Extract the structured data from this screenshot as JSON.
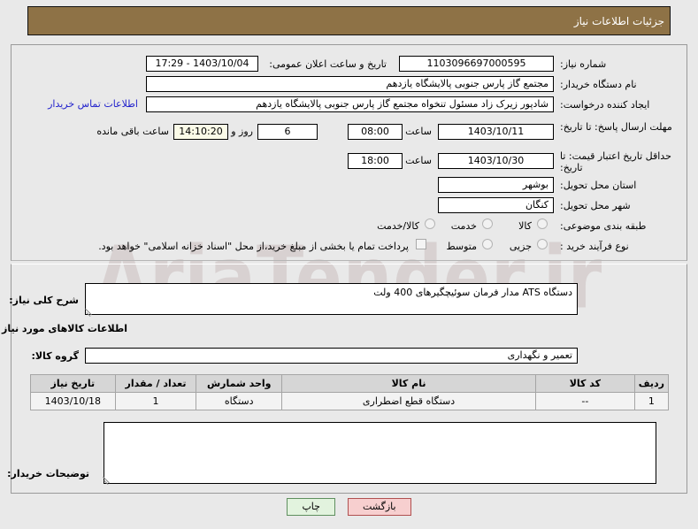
{
  "watermark": "AriaTender.ir",
  "header": {
    "title": "جزئیات اطلاعات نیاز"
  },
  "form": {
    "need_number_label": "شماره نیاز:",
    "need_number_value": "1103096697000595",
    "announce_datetime_label": "تاریخ و ساعت اعلان عمومی:",
    "announce_datetime_value": "1403/10/04 - 17:29",
    "buyer_org_label": "نام دستگاه خریدار:",
    "buyer_org_value": "مجتمع گاز پارس جنوبی  پالایشگاه یازدهم",
    "requester_label": "ایجاد کننده درخواست:",
    "requester_value": "شادپور زیرک زاد مسئول تنخواه مجتمع گاز پارس جنوبی  پالایشگاه یازدهم",
    "buyer_contact_link": "اطلاعات تماس خریدار",
    "response_deadline_label": "مهلت ارسال پاسخ: تا تاریخ:",
    "response_deadline_date": "1403/10/11",
    "hour_label": "ساعت",
    "response_deadline_time": "08:00",
    "remaining_days": "6",
    "remaining_days_label": "روز و",
    "remaining_time": "14:10:20",
    "remaining_time_label": "ساعت باقی مانده",
    "price_validity_label": "حداقل تاریخ اعتبار قیمت: تا تاریخ:",
    "price_validity_date": "1403/10/30",
    "price_validity_time": "18:00",
    "province_label": "استان محل تحویل:",
    "province_value": "بوشهر",
    "city_label": "شهر محل تحویل:",
    "city_value": "کنگان",
    "category_label": "طبقه بندی موضوعی:",
    "category_options": [
      "کالا",
      "خدمت",
      "کالا/خدمت"
    ],
    "category_selected": "",
    "purchase_type_label": "نوع فرآیند خرید :",
    "purchase_type_options": [
      "جزیی",
      "متوسط"
    ],
    "purchase_type_selected": "",
    "treasury_checkbox_text": "پرداخت تمام یا بخشی از مبلغ خرید،از محل \"اسناد خزانه اسلامی\" خواهد بود.",
    "treasury_checked": false
  },
  "need_desc": {
    "label": "شرح کلی نیاز:",
    "value": "دستگاه ATS مدار فرمان سوئیچگیرهای 400 ولت"
  },
  "goods_section": {
    "heading": "اطلاعات کالاهای مورد نیاز",
    "group_label": "گروه کالا:",
    "group_value": "تعمیر و نگهداری"
  },
  "items_table": {
    "columns": [
      "ردیف",
      "کد کالا",
      "نام کالا",
      "واحد شمارش",
      "تعداد / مقدار",
      "تاریخ نیاز"
    ],
    "rows": [
      {
        "row": "1",
        "code": "--",
        "name": "دستگاه قطع اضطراری",
        "unit": "دستگاه",
        "qty": "1",
        "need_date": "1403/10/18"
      }
    ]
  },
  "buyer_notes": {
    "label": "توضیحات خریدار:",
    "value": ""
  },
  "footer": {
    "back_label": "بازگشت",
    "print_label": "چاپ"
  },
  "colors": {
    "header_bg": "#8e7246",
    "link": "#2222cc",
    "back_btn": "#f7cfcf",
    "print_btn": "#e2f3de"
  }
}
